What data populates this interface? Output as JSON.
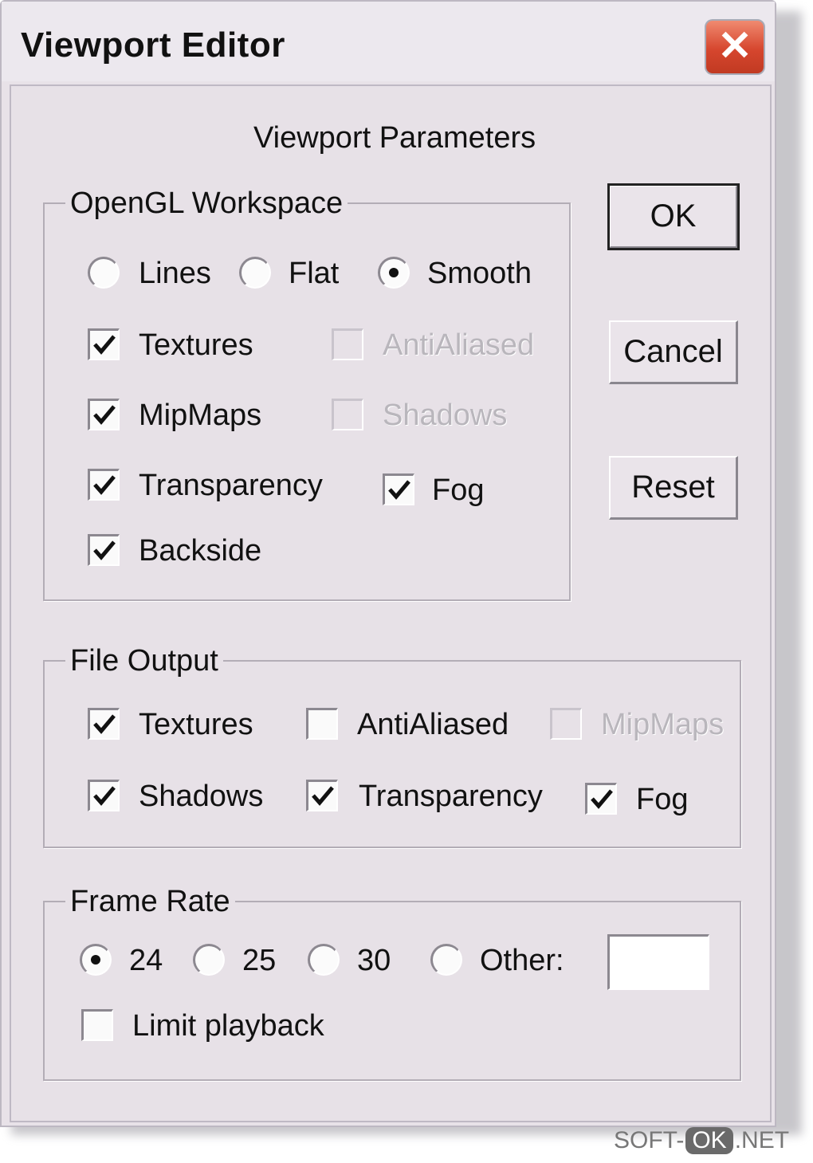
{
  "window": {
    "title": "Viewport Editor",
    "close_symbol": "✕"
  },
  "subtitle": "Viewport Parameters",
  "buttons": {
    "ok": "OK",
    "cancel": "Cancel",
    "reset": "Reset"
  },
  "opengl": {
    "legend": "OpenGL Workspace",
    "render_mode": {
      "lines": "Lines",
      "flat": "Flat",
      "smooth": "Smooth",
      "selected": "Smooth"
    },
    "textures": {
      "label": "Textures",
      "checked": true,
      "enabled": true
    },
    "antialiased": {
      "label": "AntiAliased",
      "checked": false,
      "enabled": false
    },
    "mipmaps": {
      "label": "MipMaps",
      "checked": true,
      "enabled": true
    },
    "shadows": {
      "label": "Shadows",
      "checked": false,
      "enabled": false
    },
    "transparency": {
      "label": "Transparency",
      "checked": true,
      "enabled": true
    },
    "fog": {
      "label": "Fog",
      "checked": true,
      "enabled": true
    },
    "backside": {
      "label": "Backside",
      "checked": true,
      "enabled": true
    }
  },
  "file_output": {
    "legend": "File Output",
    "textures": {
      "label": "Textures",
      "checked": true,
      "enabled": true
    },
    "antialiased": {
      "label": "AntiAliased",
      "checked": false,
      "enabled": true
    },
    "mipmaps": {
      "label": "MipMaps",
      "checked": false,
      "enabled": false
    },
    "shadows": {
      "label": "Shadows",
      "checked": true,
      "enabled": true
    },
    "transparency": {
      "label": "Transparency",
      "checked": true,
      "enabled": true
    },
    "fog": {
      "label": "Fog",
      "checked": true,
      "enabled": true
    }
  },
  "frame_rate": {
    "legend": "Frame Rate",
    "options": {
      "r24": "24",
      "r25": "25",
      "r30": "30",
      "other": "Other:"
    },
    "selected": "24",
    "other_value": "",
    "limit_playback": {
      "label": "Limit playback",
      "checked": false
    }
  },
  "watermark": {
    "left": "SOFT-",
    "mid": "OK",
    "right": ".NET"
  },
  "icons": {
    "check": "checkmark-icon",
    "close": "close-icon",
    "radio_dot": "radio-dot-icon"
  }
}
